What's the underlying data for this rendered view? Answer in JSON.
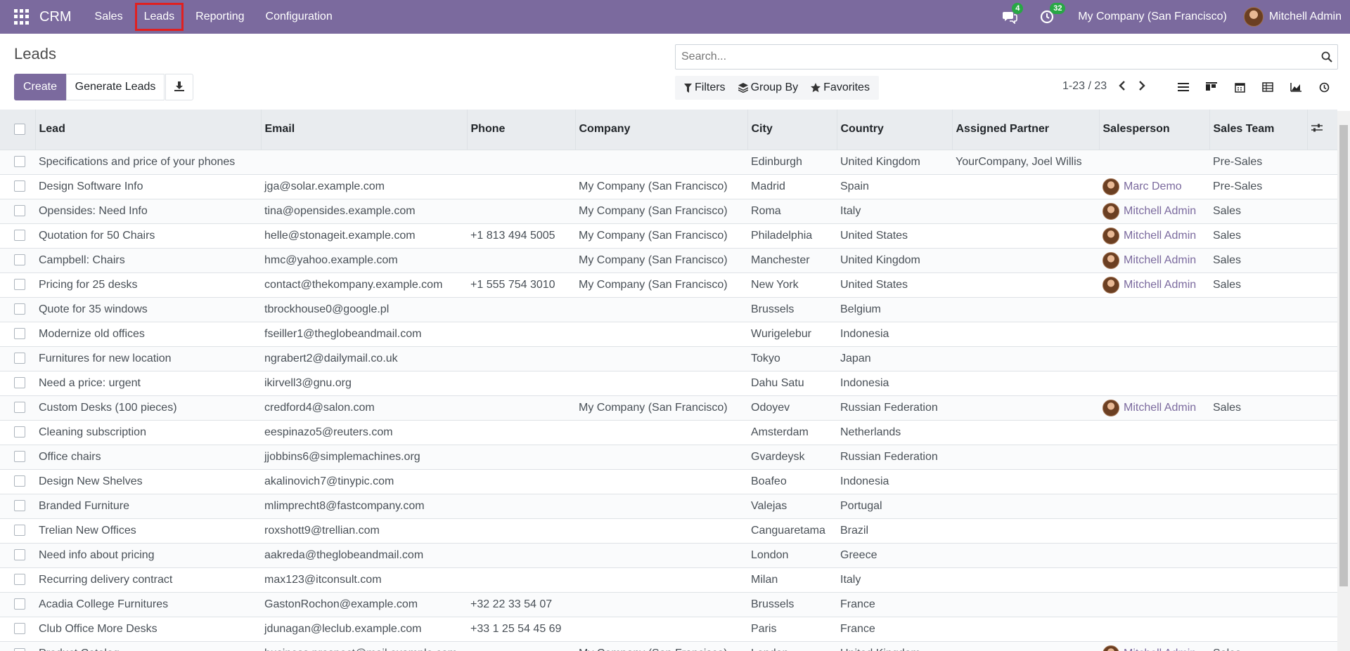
{
  "navbar": {
    "app_name": "CRM",
    "menu": [
      {
        "label": "Sales"
      },
      {
        "label": "Leads"
      },
      {
        "label": "Reporting"
      },
      {
        "label": "Configuration"
      }
    ],
    "messages_count": "4",
    "activities_count": "32",
    "company": "My Company (San Francisco)",
    "user": "Mitchell Admin",
    "accent": "#7b6a9e",
    "badge_color": "#28a745"
  },
  "control": {
    "title": "Leads",
    "create_label": "Create",
    "generate_label": "Generate Leads",
    "search_placeholder": "Search...",
    "filters_label": "Filters",
    "groupby_label": "Group By",
    "favorites_label": "Favorites",
    "pager": "1-23 / 23"
  },
  "table": {
    "columns": [
      "Lead",
      "Email",
      "Phone",
      "Company",
      "City",
      "Country",
      "Assigned Partner",
      "Salesperson",
      "Sales Team"
    ],
    "rows": [
      {
        "lead": "Specifications and price of your phones",
        "email": "",
        "phone": "",
        "company": "",
        "city": "Edinburgh",
        "country": "United Kingdom",
        "partner": "YourCompany, Joel Willis",
        "salesperson": "",
        "team": "Pre-Sales"
      },
      {
        "lead": "Design Software Info",
        "email": "jga@solar.example.com",
        "phone": "",
        "company": "My Company (San Francisco)",
        "city": "Madrid",
        "country": "Spain",
        "partner": "",
        "salesperson": "Marc Demo",
        "team": "Pre-Sales"
      },
      {
        "lead": "Opensides: Need Info",
        "email": "tina@opensides.example.com",
        "phone": "",
        "company": "My Company (San Francisco)",
        "city": "Roma",
        "country": "Italy",
        "partner": "",
        "salesperson": "Mitchell Admin",
        "team": "Sales"
      },
      {
        "lead": "Quotation for 50 Chairs",
        "email": "helle@stonageit.example.com",
        "phone": "+1 813 494 5005",
        "company": "My Company (San Francisco)",
        "city": "Philadelphia",
        "country": "United States",
        "partner": "",
        "salesperson": "Mitchell Admin",
        "team": "Sales"
      },
      {
        "lead": "Campbell: Chairs",
        "email": "hmc@yahoo.example.com",
        "phone": "",
        "company": "My Company (San Francisco)",
        "city": "Manchester",
        "country": "United Kingdom",
        "partner": "",
        "salesperson": "Mitchell Admin",
        "team": "Sales"
      },
      {
        "lead": "Pricing for 25 desks",
        "email": "contact@thekompany.example.com",
        "phone": "+1 555 754 3010",
        "company": "My Company (San Francisco)",
        "city": "New York",
        "country": "United States",
        "partner": "",
        "salesperson": "Mitchell Admin",
        "team": "Sales"
      },
      {
        "lead": "Quote for 35 windows",
        "email": "tbrockhouse0@google.pl",
        "phone": "",
        "company": "",
        "city": "Brussels",
        "country": "Belgium",
        "partner": "",
        "salesperson": "",
        "team": ""
      },
      {
        "lead": "Modernize old offices",
        "email": "fseiller1@theglobeandmail.com",
        "phone": "",
        "company": "",
        "city": "Wurigelebur",
        "country": "Indonesia",
        "partner": "",
        "salesperson": "",
        "team": ""
      },
      {
        "lead": "Furnitures for new location",
        "email": "ngrabert2@dailymail.co.uk",
        "phone": "",
        "company": "",
        "city": "Tokyo",
        "country": "Japan",
        "partner": "",
        "salesperson": "",
        "team": ""
      },
      {
        "lead": "Need a price: urgent",
        "email": "ikirvell3@gnu.org",
        "phone": "",
        "company": "",
        "city": "Dahu Satu",
        "country": "Indonesia",
        "partner": "",
        "salesperson": "",
        "team": ""
      },
      {
        "lead": "Custom Desks (100 pieces)",
        "email": "credford4@salon.com",
        "phone": "",
        "company": "My Company (San Francisco)",
        "city": "Odoyev",
        "country": "Russian Federation",
        "partner": "",
        "salesperson": "Mitchell Admin",
        "team": "Sales"
      },
      {
        "lead": "Cleaning subscription",
        "email": "eespinazo5@reuters.com",
        "phone": "",
        "company": "",
        "city": "Amsterdam",
        "country": "Netherlands",
        "partner": "",
        "salesperson": "",
        "team": ""
      },
      {
        "lead": "Office chairs",
        "email": "jjobbins6@simplemachines.org",
        "phone": "",
        "company": "",
        "city": "Gvardeysk",
        "country": "Russian Federation",
        "partner": "",
        "salesperson": "",
        "team": ""
      },
      {
        "lead": "Design New Shelves",
        "email": "akalinovich7@tinypic.com",
        "phone": "",
        "company": "",
        "city": "Boafeo",
        "country": "Indonesia",
        "partner": "",
        "salesperson": "",
        "team": ""
      },
      {
        "lead": "Branded Furniture",
        "email": "mlimprecht8@fastcompany.com",
        "phone": "",
        "company": "",
        "city": "Valejas",
        "country": "Portugal",
        "partner": "",
        "salesperson": "",
        "team": ""
      },
      {
        "lead": "Trelian New Offices",
        "email": "roxshott9@trellian.com",
        "phone": "",
        "company": "",
        "city": "Canguaretama",
        "country": "Brazil",
        "partner": "",
        "salesperson": "",
        "team": ""
      },
      {
        "lead": "Need info about pricing",
        "email": "aakreda@theglobeandmail.com",
        "phone": "",
        "company": "",
        "city": "London",
        "country": "Greece",
        "partner": "",
        "salesperson": "",
        "team": ""
      },
      {
        "lead": "Recurring delivery contract",
        "email": "max123@itconsult.com",
        "phone": "",
        "company": "",
        "city": "Milan",
        "country": "Italy",
        "partner": "",
        "salesperson": "",
        "team": ""
      },
      {
        "lead": "Acadia College Furnitures",
        "email": "GastonRochon@example.com",
        "phone": "+32 22 33 54 07",
        "company": "",
        "city": "Brussels",
        "country": "France",
        "partner": "",
        "salesperson": "",
        "team": ""
      },
      {
        "lead": "Club Office More Desks",
        "email": "jdunagan@leclub.example.com",
        "phone": "+33 1 25 54 45 69",
        "company": "",
        "city": "Paris",
        "country": "France",
        "partner": "",
        "salesperson": "",
        "team": ""
      },
      {
        "lead": "Product Catalog",
        "email": "business.prospect@mail.example.com",
        "phone": "",
        "company": "My Company (San Francisco)",
        "city": "London",
        "country": "United Kingdom",
        "partner": "",
        "salesperson": "Mitchell Admin",
        "team": "Sales"
      }
    ]
  }
}
